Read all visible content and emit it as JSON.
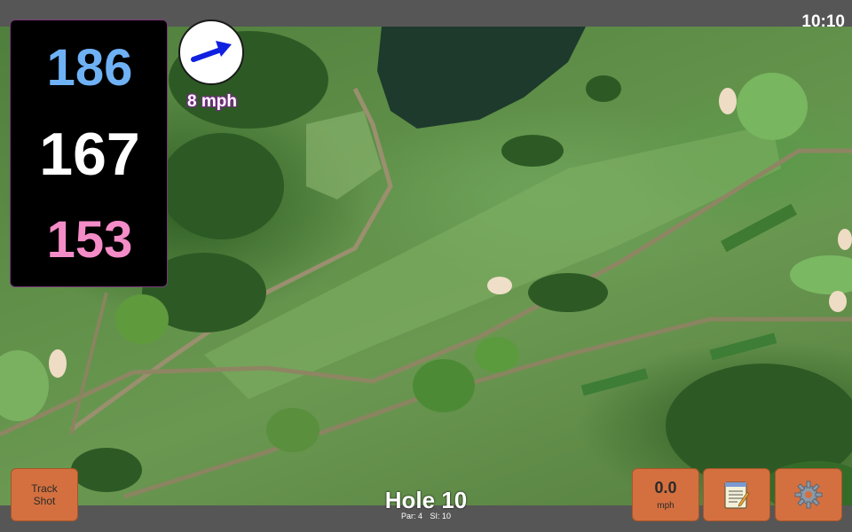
{
  "status_bar": {
    "time": "10:10"
  },
  "distances": {
    "back": "186",
    "middle": "167",
    "front": "153"
  },
  "wind": {
    "speed_text": "8 mph",
    "direction_icon": "arrow-up-right-icon"
  },
  "buttons": {
    "track_shot_line1": "Track",
    "track_shot_line2": "Shot",
    "wind_value": "0.0",
    "wind_unit": "mph",
    "notes_icon": "notepad-icon",
    "settings_icon": "gear-icon"
  },
  "hole": {
    "title": "Hole 10",
    "par": "Par: 4",
    "si": "SI: 10"
  },
  "colors": {
    "back_distance": "#6fb1f5",
    "middle_distance": "#ffffff",
    "front_distance": "#f48cc8",
    "button_bg": "#d4703f",
    "wind_arrow": "#1020e0"
  }
}
